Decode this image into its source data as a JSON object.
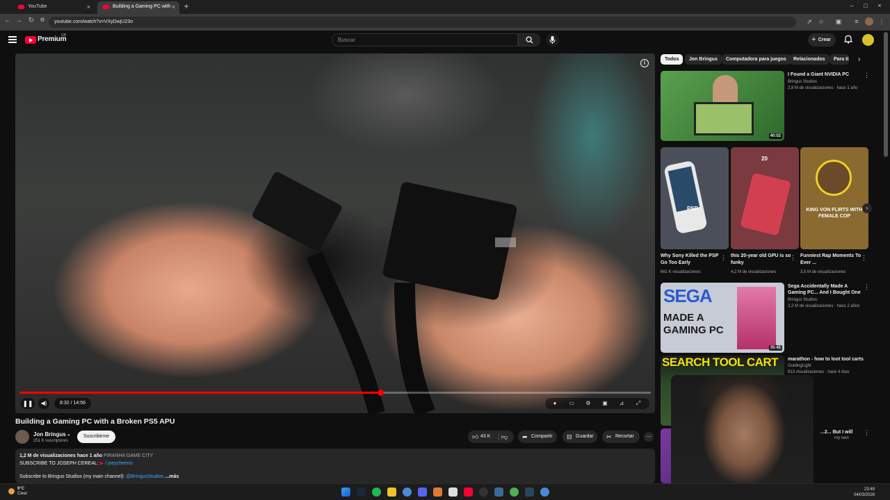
{
  "browser": {
    "tabs": [
      {
        "title": "YouTube"
      },
      {
        "title": "Building a Gaming PC with"
      }
    ],
    "url": "youtube.com/watch?v=VXyDwjU23o"
  },
  "header": {
    "logo_text": "Premium",
    "country_code": "GB",
    "search_placeholder": "Buscar",
    "create_label": "Crear"
  },
  "player": {
    "time": "8:32 / 14:56",
    "progress_fraction": 0.572
  },
  "video": {
    "title": "Building a Gaming PC with a Broken PS5 APU",
    "channel": "Jon Bringus",
    "subscribers": "251 K suscriptores",
    "subscribe_label": "Suscribirme",
    "likes": "43 K",
    "share_label": "Compartir",
    "save_label": "Guardar",
    "clip_label": "Recortar",
    "views_line": "1,2 M de visualizaciones  hace 1 año",
    "tag": "PIRANHA GAME CITY",
    "desc_line1_prefix": "SUBSCRIBE TO JOSEPH CEREAL:",
    "desc_line1_link": "/ joeycheerio",
    "desc_line2_prefix": "Subscribe to Bringus Studios (my main channel):",
    "desc_line2_link": "@BringusStudios",
    "more_label": "...más"
  },
  "chips": [
    "Todos",
    "Jon Bringus",
    "Computadora para juegos",
    "Relacionados",
    "Para ti"
  ],
  "recommendations": [
    {
      "title": "I Found a Giant NVIDIA PC",
      "channel": "Bringus Studios",
      "meta": "2,8 M de visualizaciones · hace 1 año",
      "duration": "40:02",
      "color": "#3f8a3a"
    },
    {
      "title": "Sega Accidentally Made A",
      "title2": "Gaming PC... And I Bought One",
      "channel": "Bringus Studios",
      "meta": "2,2 M de visualizaciones · hace 2 años",
      "duration": "35:45",
      "color": "#c23b6f"
    },
    {
      "title": "marathon - how to loot tool carts",
      "channel": "GuidingLight",
      "meta": "813 visualizaciones · hace 4 días",
      "duration": "",
      "color": "#2c4a2a"
    },
    {
      "title": "...2... But I will",
      "channel": "my own",
      "meta": "",
      "duration": "",
      "color": "#5a2a7a"
    }
  ],
  "thumb_texts": {
    "sega1": "SEGA",
    "sega2": "MADE A",
    "sega3": "GAMING PC",
    "search": "SEARCH TOOL CART",
    "psp": "PSP",
    "king": "KING VON FLIRTS WITH FEMALE COP",
    "gpu_count": "20"
  },
  "shorts": [
    {
      "title": "Why Sony Killed the PSP Go Too Early",
      "meta": "661 K visualizaciones",
      "color": "#4b4f5a"
    },
    {
      "title": "this 20-year old GPU is so funky",
      "meta": "4,2 M de visualizaciones",
      "color": "#7a3a40"
    },
    {
      "title": "Funniest Rap Moments To Ever ...",
      "meta": "3,5 M de visualizaciones",
      "color": "#8a6a30"
    }
  ],
  "taskbar": {
    "temp": "9°C",
    "weather": "Clear",
    "time": "23:49",
    "date": "04/03/2026"
  }
}
